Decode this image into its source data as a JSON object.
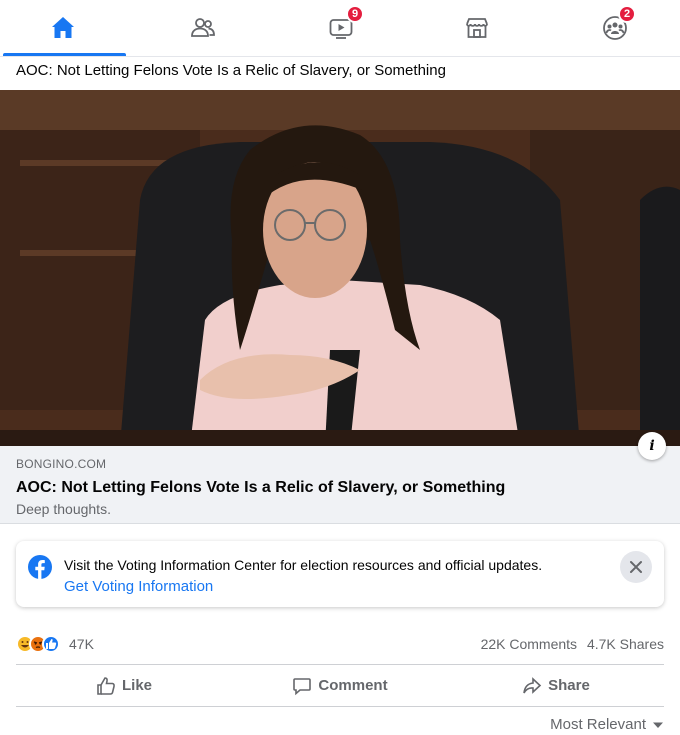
{
  "nav": {
    "tabs": [
      {
        "name": "home",
        "icon": "home-icon",
        "active": true
      },
      {
        "name": "friends",
        "icon": "friends-icon",
        "active": false
      },
      {
        "name": "watch",
        "icon": "watch-icon",
        "active": false,
        "badge": "9"
      },
      {
        "name": "marketplace",
        "icon": "marketplace-icon",
        "active": false
      },
      {
        "name": "groups",
        "icon": "groups-icon",
        "active": false,
        "badge": "2"
      }
    ]
  },
  "post": {
    "text": "AOC: Not Letting Felons Vote Is a Relic of Slavery, or Something"
  },
  "link_preview": {
    "domain": "BONGINO.COM",
    "title": "AOC: Not Letting Felons Vote Is a Relic of Slavery, or Something",
    "description": "Deep thoughts."
  },
  "voting_info": {
    "text": "Visit the Voting Information Center for election resources and official updates.",
    "link": "Get Voting Information"
  },
  "stats": {
    "reaction_count": "47K",
    "comments": "22K Comments",
    "shares": "4.7K Shares"
  },
  "actions": {
    "like": "Like",
    "comment": "Comment",
    "share": "Share"
  },
  "sort": {
    "label": "Most Relevant"
  },
  "colors": {
    "accent": "#1877f2",
    "badge": "#e41e3f",
    "secondary_text": "#65676b"
  }
}
